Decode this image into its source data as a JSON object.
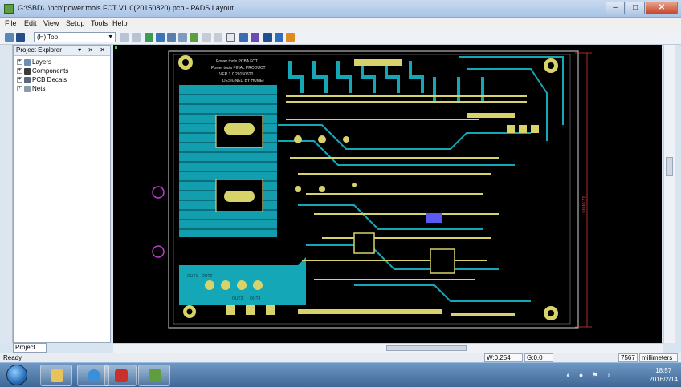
{
  "window": {
    "title": "G:\\SBD\\..\\pcb\\power tools FCT V1.0(20150820).pcb - PADS Layout",
    "minimize": "–",
    "maximize": "□",
    "close": "✕"
  },
  "menu": [
    "File",
    "Edit",
    "View",
    "Setup",
    "Tools",
    "Help"
  ],
  "toolbar": {
    "layer_value": "(H) Top"
  },
  "explorer": {
    "title": "Project Explorer",
    "controls": "▾ ⨯ ✕",
    "items": [
      {
        "label": "Layers",
        "icon": "layers-icon"
      },
      {
        "label": "Components",
        "icon": "components-icon"
      },
      {
        "label": "PCB Decals",
        "icon": "decals-icon"
      },
      {
        "label": "Nets",
        "icon": "nets-icon"
      }
    ],
    "tab_label": "Project"
  },
  "board": {
    "silk_text": [
      "Power tools PCBA FCT",
      "Power tools FINAL PRODUCT",
      "VER 1.0 20150820",
      "DESIGNED BY HUMEI"
    ],
    "dimension_label": "92.0mm",
    "labels": [
      "OUT1",
      "OUT2",
      "OUT3",
      "OUT4"
    ],
    "colors": {
      "copper": "#13a7b8",
      "pads": "#d8d26a",
      "outline": "#d9d9d9",
      "background": "#000000",
      "dimension": "#d83a3a",
      "marker": "#c13bd1"
    }
  },
  "statusbar": {
    "ready": "Ready",
    "w_field": "W:0.254",
    "g_field": "G:0.0",
    "unit_value": "7567",
    "unit": "millimeters"
  },
  "taskbar": {
    "time": "18:57",
    "date": "2016/2/14"
  }
}
